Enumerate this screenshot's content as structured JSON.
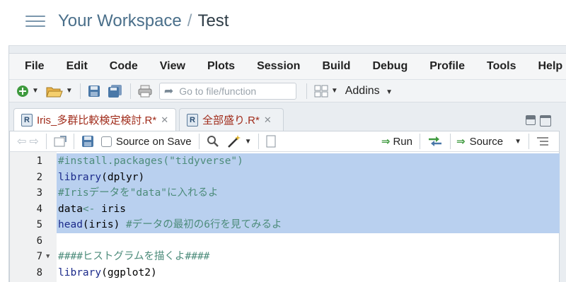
{
  "header": {
    "menu_icon": "hamburger-icon",
    "workspace": "Your Workspace",
    "separator": "/",
    "project": "Test"
  },
  "menubar": [
    "File",
    "Edit",
    "Code",
    "View",
    "Plots",
    "Session",
    "Build",
    "Debug",
    "Profile",
    "Tools",
    "Help"
  ],
  "toolbar": {
    "goto_placeholder": "Go to file/function",
    "addins_label": "Addins",
    "icons": [
      "new-file-icon",
      "open-folder-icon",
      "save-icon",
      "save-all-icon",
      "print-icon",
      "grid-icon"
    ]
  },
  "tabs": [
    {
      "label": "Iris_多群比較検定検討.R*",
      "active": true
    },
    {
      "label": "全部盛り.R*",
      "active": false
    }
  ],
  "editor_toolbar": {
    "source_on_save": "Source on Save",
    "run": "Run",
    "source": "Source"
  },
  "code_lines": [
    {
      "n": "1",
      "text": "#install.packages(\"tidyverse\")",
      "selected": true,
      "fold": false
    },
    {
      "n": "2",
      "text": "library(dplyr)",
      "selected": true,
      "fold": false
    },
    {
      "n": "3",
      "text": "#Irisデータを\"data\"に入れるよ",
      "selected": true,
      "fold": false
    },
    {
      "n": "4",
      "text": "data<- iris",
      "selected": true,
      "fold": false
    },
    {
      "n": "5",
      "text": "head(iris) #データの最初の6行を見てみるよ",
      "selected": true,
      "fold": false
    },
    {
      "n": "6",
      "text": "",
      "selected": false,
      "fold": false
    },
    {
      "n": "7",
      "text": "####ヒストグラムを描くよ####",
      "selected": false,
      "fold": true
    },
    {
      "n": "8",
      "text": "library(ggplot2)",
      "selected": false,
      "fold": false
    }
  ],
  "colors": {
    "selection": "#b9d0ef",
    "comment": "#4d8c7b",
    "function": "#1b2a8a",
    "tab_text": "#a02b1a"
  }
}
